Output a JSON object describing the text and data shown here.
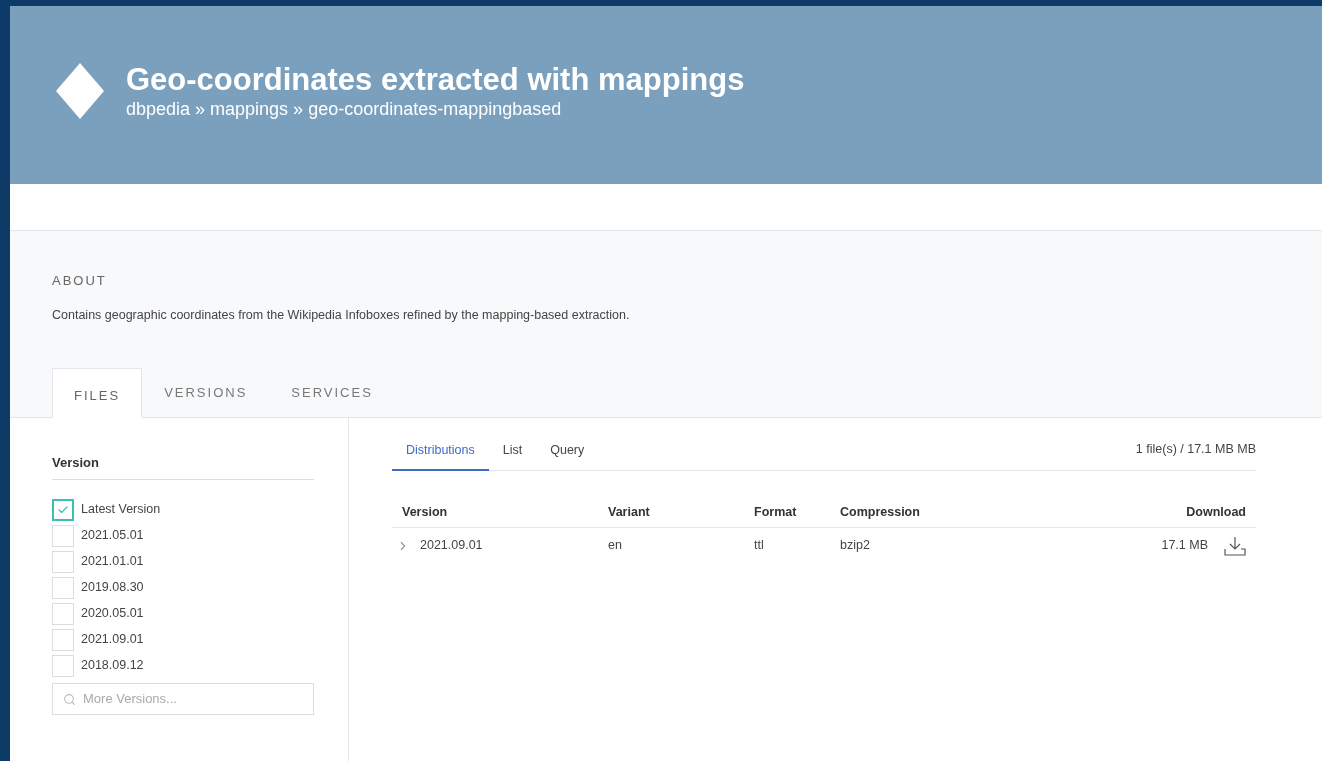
{
  "header": {
    "title": "Geo-coordinates extracted with mappings",
    "breadcrumb": "dbpedia » mappings » geo-coordinates-mappingbased"
  },
  "about": {
    "heading": "ABOUT",
    "text": "Contains geographic coordinates from the Wikipedia Infoboxes refined by the mapping-based extraction."
  },
  "tabs": [
    {
      "label": "FILES",
      "selected": true
    },
    {
      "label": "VERSIONS",
      "selected": false
    },
    {
      "label": "SERVICES",
      "selected": false
    }
  ],
  "version_filter": {
    "heading": "Version",
    "options": [
      {
        "label": "Latest Version",
        "checked": true
      },
      {
        "label": "2021.05.01",
        "checked": false
      },
      {
        "label": "2021.01.01",
        "checked": false
      },
      {
        "label": "2019.08.30",
        "checked": false
      },
      {
        "label": "2020.05.01",
        "checked": false
      },
      {
        "label": "2021.09.01",
        "checked": false
      },
      {
        "label": "2018.09.12",
        "checked": false
      }
    ],
    "search": {
      "placeholder": "More Versions..."
    }
  },
  "subtabs": [
    {
      "label": "Distributions",
      "selected": true
    },
    {
      "label": "List",
      "selected": false
    },
    {
      "label": "Query",
      "selected": false
    }
  ],
  "summary": "1 file(s) / 17.1 MB MB",
  "table": {
    "columns": [
      "Version",
      "Variant",
      "Format",
      "Compression",
      "Download"
    ],
    "rows": [
      {
        "version": "2021.09.01",
        "variant": "en",
        "format": "ttl",
        "compression": "bzip2",
        "size": "17.1 MB"
      }
    ]
  }
}
